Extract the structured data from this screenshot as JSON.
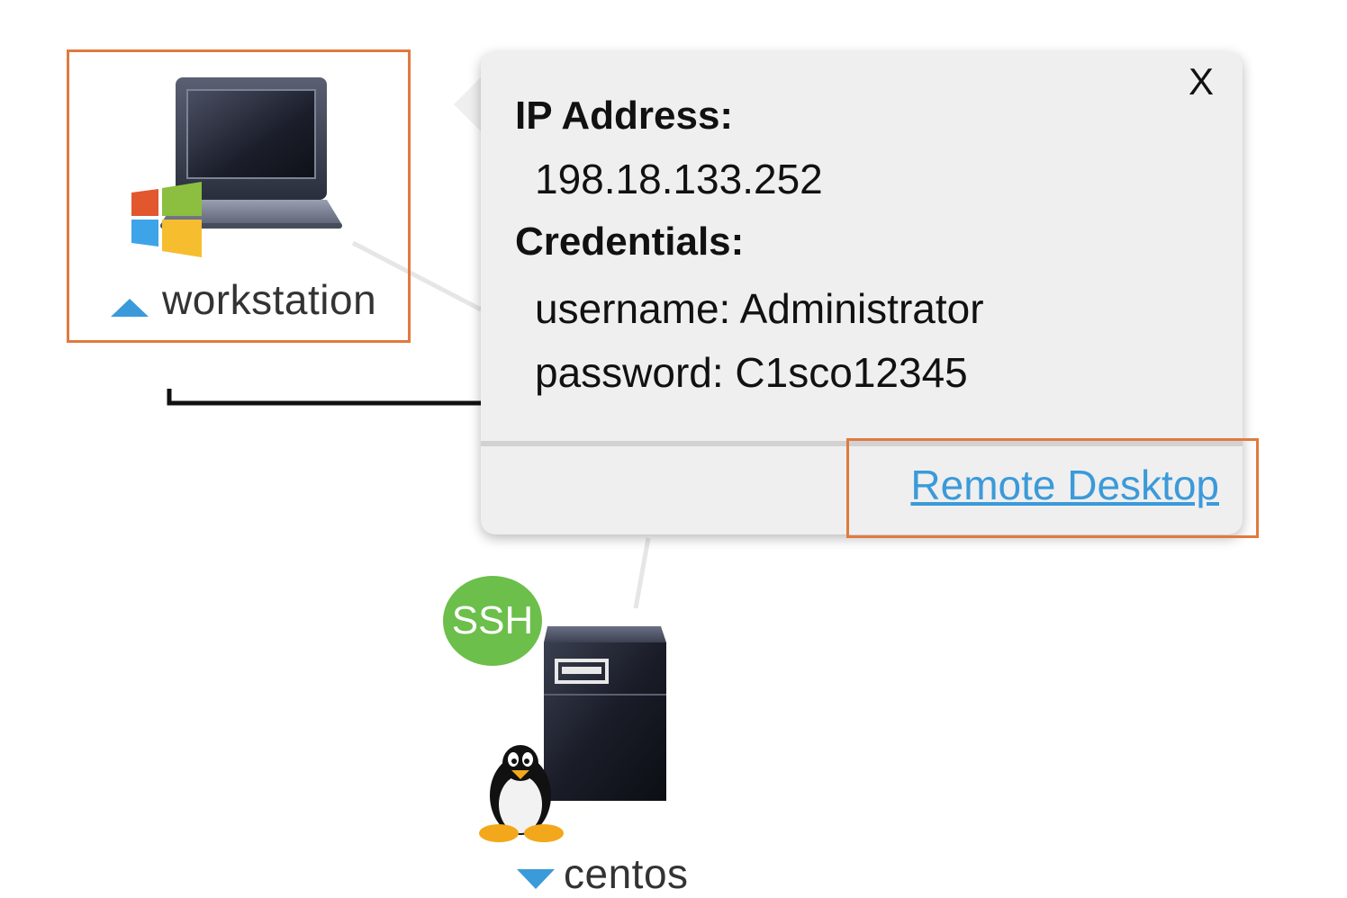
{
  "workstation": {
    "label": "workstation",
    "expand_icon": "triangle-up-icon",
    "device_icon": "laptop-windows-icon"
  },
  "popover": {
    "close_label": "X",
    "ip_heading": "IP Address:",
    "ip_value": "198.18.133.252",
    "credentials_heading": "Credentials:",
    "username_line": "username: Administrator",
    "password_line": "password: C1sco12345",
    "remote_desktop_label": "Remote Desktop"
  },
  "centos": {
    "label": "centos",
    "ssh_badge": "SSH",
    "expand_icon": "triangle-down-icon",
    "device_icon": "server-linux-icon"
  },
  "colors": {
    "highlight": "#e07a3f",
    "link": "#3b9ad9",
    "ssh_badge": "#6bbf4a",
    "node_triangle": "#3b9ad9",
    "popover_bg": "#efefef"
  }
}
